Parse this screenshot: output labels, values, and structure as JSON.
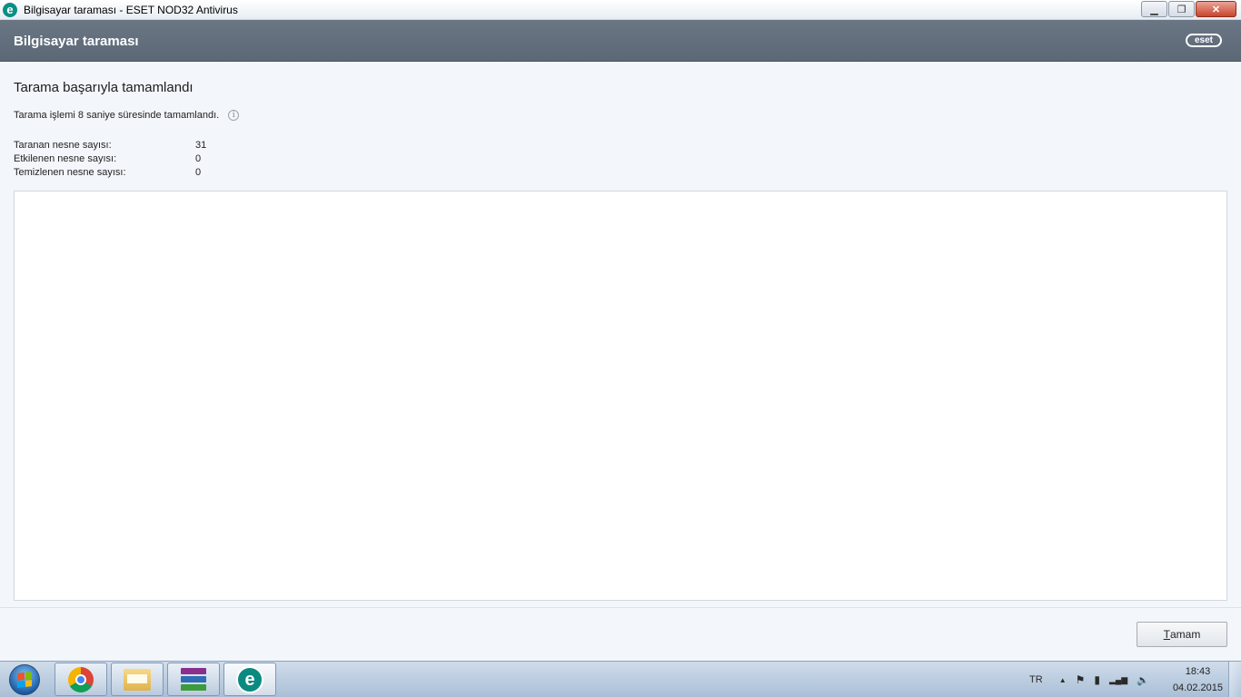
{
  "window": {
    "title": "Bilgisayar taraması - ESET NOD32 Antivirus",
    "app_icon_letter": "e",
    "controls": {
      "minimize": "▁",
      "restore": "❐",
      "close": "✕"
    }
  },
  "header": {
    "title": "Bilgisayar taraması",
    "logo_text": "eset"
  },
  "main": {
    "heading": "Tarama başarıyla tamamlandı",
    "duration_text": "Tarama işlemi 8 saniye süresinde tamamlandı.",
    "info_icon_glyph": "i",
    "stats": [
      {
        "label": "Taranan nesne sayısı:",
        "value": "31"
      },
      {
        "label": "Etkilenen nesne sayısı:",
        "value": "0"
      },
      {
        "label": "Temizlenen nesne sayısı:",
        "value": "0"
      }
    ],
    "ok_button": {
      "mnemonic": "T",
      "rest": "amam"
    }
  },
  "taskbar": {
    "apps": [
      "chrome-icon",
      "file-explorer-icon",
      "winrar-icon",
      "eset-icon"
    ],
    "eset_letter": "e",
    "tray": {
      "language": "TR",
      "icons": {
        "show_hidden": "▲",
        "action_center": "⚑",
        "power": "▮",
        "network": "▂▄▆",
        "volume": "🔈"
      },
      "time": "18:43",
      "date": "04.02.2015"
    }
  },
  "colors": {
    "header_bg": "#616d7b",
    "eset_teal": "#0a8f84",
    "content_bg": "#f3f6fa"
  }
}
